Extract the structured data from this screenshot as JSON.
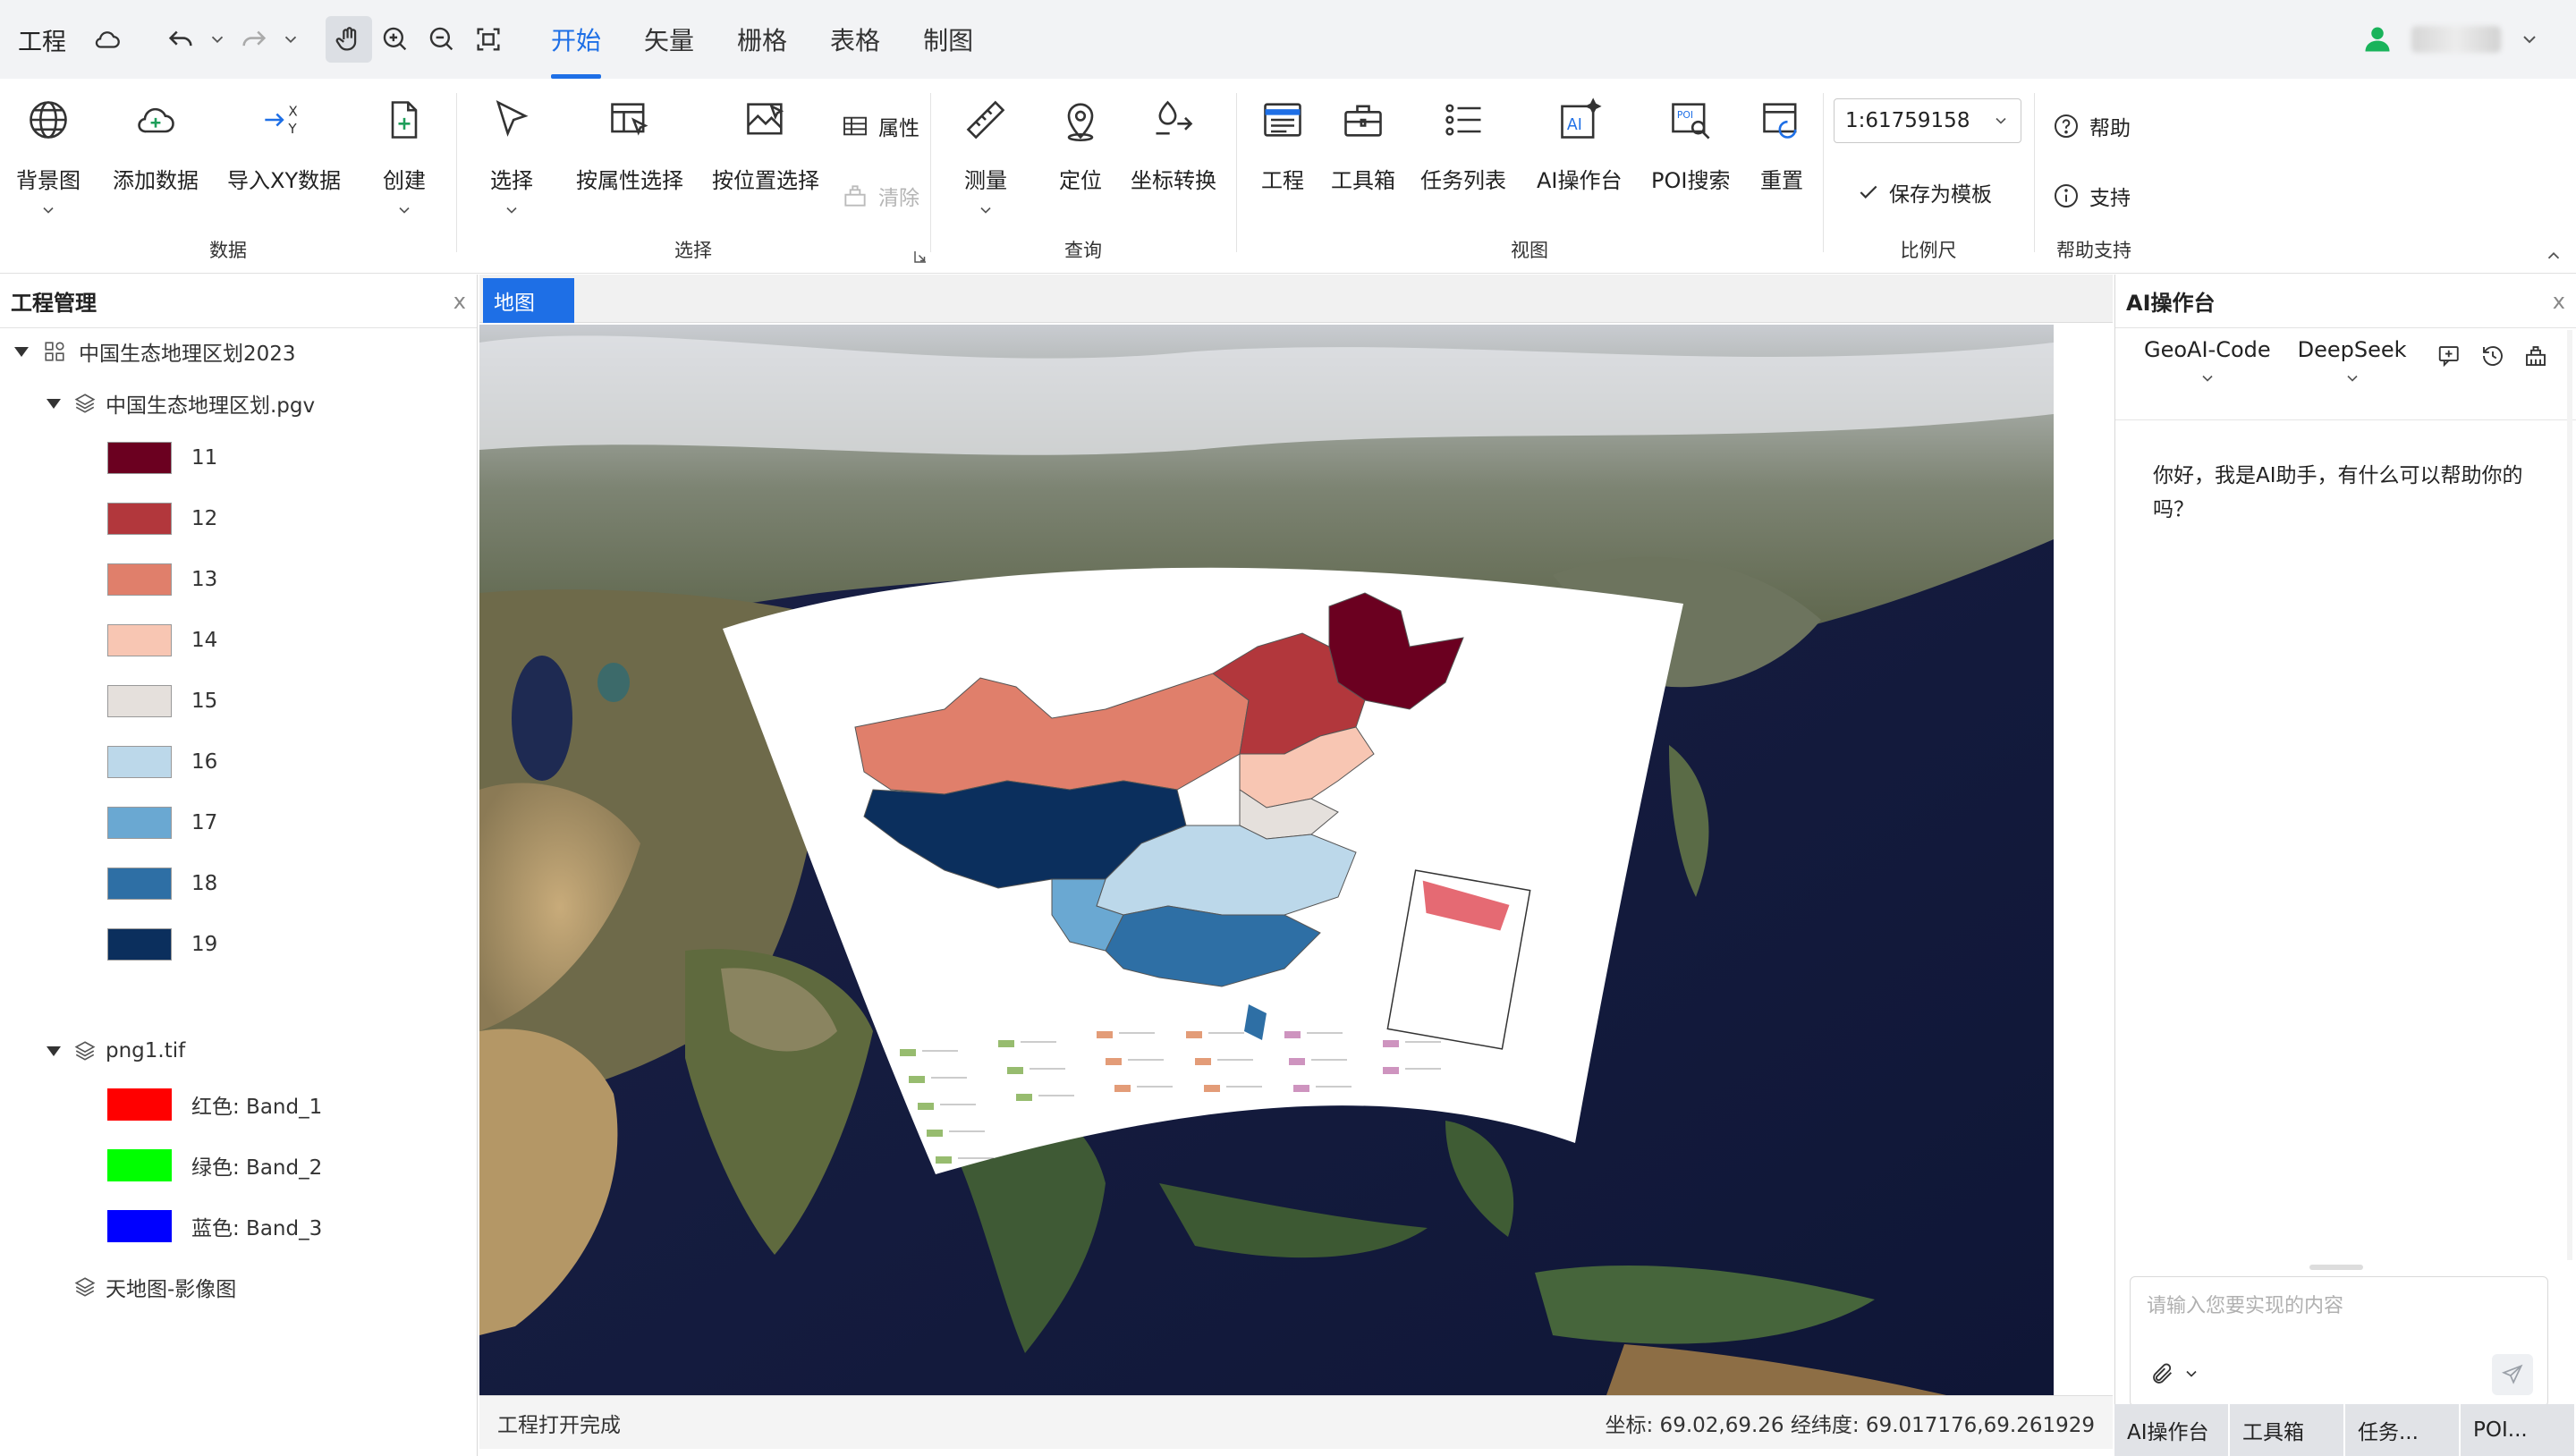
{
  "menubar": {
    "project_label": "工程",
    "tabs": [
      {
        "label": "开始",
        "active": true
      },
      {
        "label": "矢量",
        "active": false
      },
      {
        "label": "栅格",
        "active": false
      },
      {
        "label": "表格",
        "active": false
      },
      {
        "label": "制图",
        "active": false
      }
    ]
  },
  "ribbon": {
    "data_group": {
      "title": "数据",
      "basemap": "背景图",
      "add_data": "添加数据",
      "import_xy": "导入XY数据",
      "create": "创建"
    },
    "select_group": {
      "title": "选择",
      "select": "选择",
      "by_attr": "按属性选择",
      "by_location": "按位置选择",
      "attributes": "属性",
      "clear": "清除"
    },
    "query_group": {
      "title": "查询",
      "measure": "测量",
      "locate": "定位",
      "coord_convert": "坐标转换"
    },
    "view_group": {
      "title": "视图",
      "project": "工程",
      "toolbox": "工具箱",
      "task_list": "任务列表",
      "ai_console": "AI操作台",
      "poi_search": "POI搜索",
      "reset": "重置"
    },
    "scale_group": {
      "title": "比例尺",
      "value": "1:61759158",
      "save_template": "保存为模板"
    },
    "help_group": {
      "title": "帮助支持",
      "help": "帮助",
      "support": "支持"
    }
  },
  "left_panel": {
    "title": "工程管理",
    "close": "x",
    "root": "中国生态地理区划2023",
    "layer1": {
      "name": "中国生态地理区划.pgv",
      "legend": [
        {
          "label": "11",
          "color": "#6b0020"
        },
        {
          "label": "12",
          "color": "#b2373c"
        },
        {
          "label": "13",
          "color": "#e07f6b"
        },
        {
          "label": "14",
          "color": "#f8c6b3"
        },
        {
          "label": "15",
          "color": "#e5e0dc"
        },
        {
          "label": "16",
          "color": "#bcd8ea"
        },
        {
          "label": "17",
          "color": "#6aa8d2"
        },
        {
          "label": "18",
          "color": "#2e6fa5"
        },
        {
          "label": "19",
          "color": "#0b2f5d"
        }
      ]
    },
    "layer2": {
      "name": "png1.tif",
      "bands": [
        {
          "label": "红色: Band_1",
          "color": "#ff0000"
        },
        {
          "label": "绿色: Band_2",
          "color": "#00ff00"
        },
        {
          "label": "蓝色: Band_3",
          "color": "#0000ff"
        }
      ]
    },
    "layer3": {
      "name": "天地图-影像图"
    }
  },
  "map": {
    "tab_label": "地图",
    "status_left": "工程打开完成",
    "status_right": "坐标: 69.02,69.26 经纬度: 69.017176,69.261929"
  },
  "right_panel": {
    "title": "AI操作台",
    "close": "x",
    "model1": "GeoAI-Code",
    "model2": "DeepSeek",
    "greeting": "你好，我是AI助手，有什么可以帮助你的吗？",
    "input_placeholder": "请输入您要实现的内容",
    "bottom_tabs": [
      "AI操作台",
      "工具箱",
      "任务...",
      "POI..."
    ]
  }
}
